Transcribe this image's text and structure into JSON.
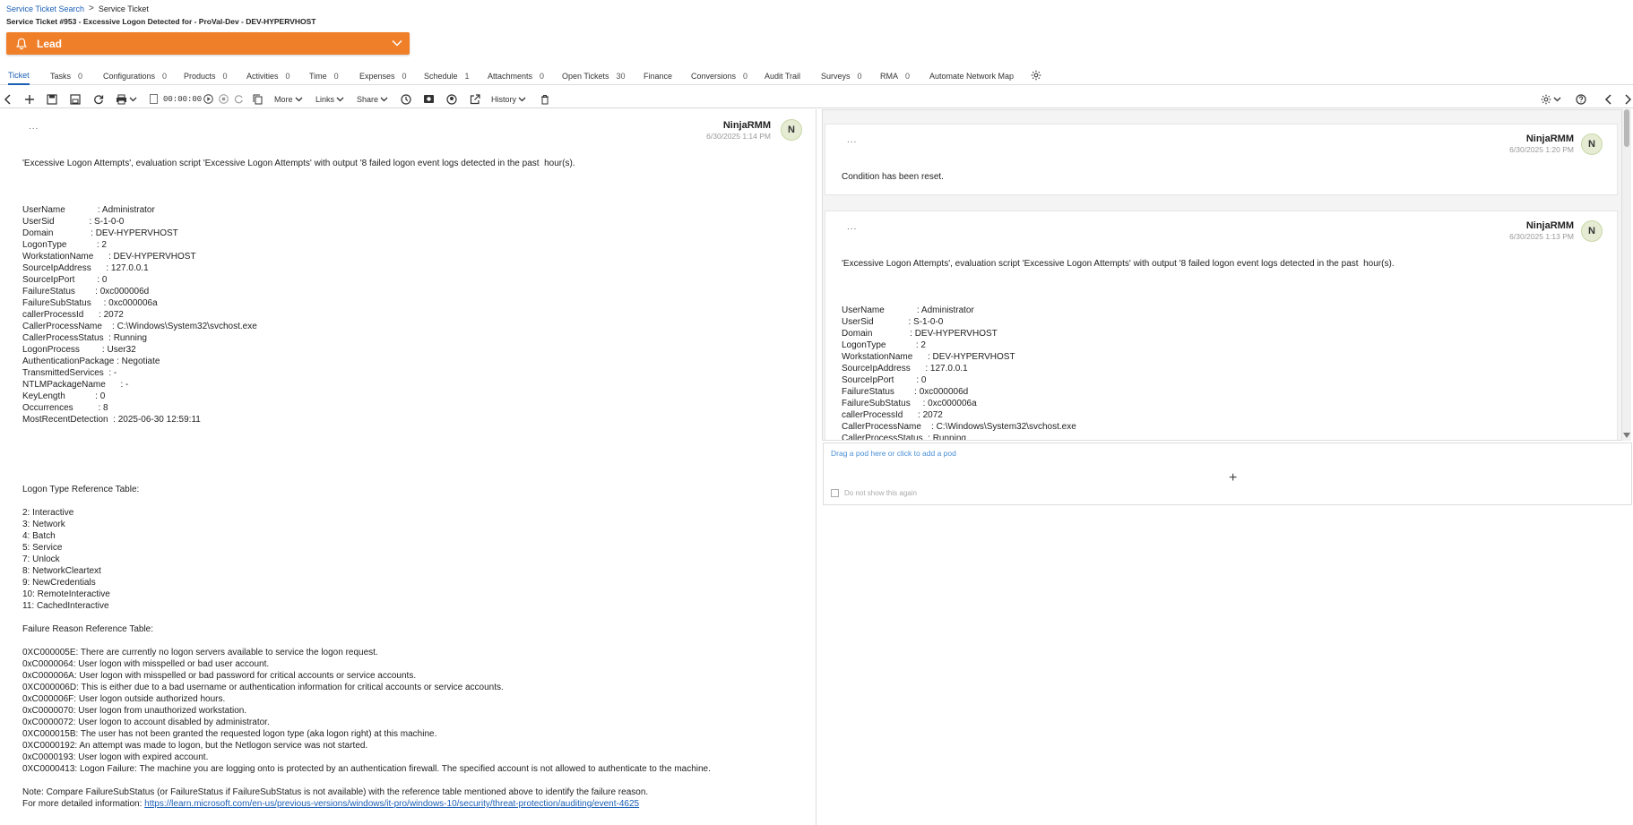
{
  "breadcrumb": {
    "search_link": "Service Ticket Search",
    "separator": ">",
    "current": "Service Ticket"
  },
  "title": "Service Ticket #953 - Excessive Logon Detected for - ProVal-Dev - DEV-HYPERVHOST",
  "status": {
    "label": "Lead",
    "color": "#f07f2a"
  },
  "tabs": [
    {
      "label": "Ticket",
      "count": ""
    },
    {
      "label": "Tasks",
      "count": "0"
    },
    {
      "label": "Configurations",
      "count": "0"
    },
    {
      "label": "Products",
      "count": "0"
    },
    {
      "label": "Activities",
      "count": "0"
    },
    {
      "label": "Time",
      "count": "0"
    },
    {
      "label": "Expenses",
      "count": "0"
    },
    {
      "label": "Schedule",
      "count": "1"
    },
    {
      "label": "Attachments",
      "count": "0"
    },
    {
      "label": "Open Tickets",
      "count": "30"
    },
    {
      "label": "Finance",
      "count": ""
    },
    {
      "label": "Conversions",
      "count": "0"
    },
    {
      "label": "Audit Trail",
      "count": ""
    },
    {
      "label": "Surveys",
      "count": "0"
    },
    {
      "label": "RMA",
      "count": "0"
    },
    {
      "label": "Automate Network Map",
      "count": ""
    }
  ],
  "toolbar": {
    "timer": "00:00:00",
    "more": "More",
    "links": "Links",
    "share": "Share",
    "history": "History"
  },
  "left_note": {
    "dots": "...",
    "author": "NinjaRMM",
    "date": "6/30/2025 1:14 PM",
    "avatar": "N",
    "body": "'Excessive Logon Attempts', evaluation script 'Excessive Logon Attempts' with output '8 failed logon event logs detected in the past  hour(s).\n\n\n\nUserName             : Administrator\nUserSid              : S-1-0-0\nDomain               : DEV-HYPERVHOST\nLogonType            : 2\nWorkstationName      : DEV-HYPERVHOST\nSourceIpAddress      : 127.0.0.1\nSourceIpPort         : 0\nFailureStatus        : 0xc000006d\nFailureSubStatus     : 0xc000006a\ncallerProcessId      : 2072\nCallerProcessName    : C:\\Windows\\System32\\svchost.exe\nCallerProcessStatus  : Running\nLogonProcess         : User32\nAuthenticationPackage : Negotiate\nTransmittedServices  : -\nNTLMPackageName      : -\nKeyLength            : 0\nOccurrences          : 8\nMostRecentDetection  : 2025-06-30 12:59:11\n\n\n\n\n\nLogon Type Reference Table:\n\n2: Interactive\n3: Network\n4: Batch\n5: Service\n7: Unlock\n8: NetworkCleartext\n9: NewCredentials\n10: RemoteInteractive\n11: CachedInteractive\n\nFailure Reason Reference Table:\n\n0XC000005E: There are currently no logon servers available to service the logon request.\n0xC0000064: User logon with misspelled or bad user account.\n0xC000006A: User logon with misspelled or bad password for critical accounts or service accounts.\n0XC000006D: This is either due to a bad username or authentication information for critical accounts or service accounts.\n0xC000006F: User logon outside authorized hours.\n0xC0000070: User logon from unauthorized workstation.\n0xC0000072: User logon to account disabled by administrator.\n0XC000015B: The user has not been granted the requested logon type (aka logon right) at this machine.\n0XC0000192: An attempt was made to logon, but the Netlogon service was not started.\n0xC0000193: User logon with expired account.\n0XC0000413: Logon Failure: The machine you are logging onto is protected by an authentication firewall. The specified account is not allowed to authenticate to the machine.\n\nNote: Compare FailureSubStatus (or FailureStatus if FailureSubStatus is not available) with the reference table mentioned above to identify the failure reason.\n",
    "more_info_label": "For more detailed information: ",
    "more_info_link": "https://learn.microsoft.com/en-us/previous-versions/windows/it-pro/windows-10/security/threat-protection/auditing/event-4625"
  },
  "right_notes": [
    {
      "dots": "...",
      "author": "NinjaRMM",
      "date": "6/30/2025 1:20 PM",
      "avatar": "N",
      "body": "Condition has been reset."
    },
    {
      "dots": "...",
      "author": "NinjaRMM",
      "date": "6/30/2025 1:13 PM",
      "avatar": "N",
      "body": "'Excessive Logon Attempts', evaluation script 'Excessive Logon Attempts' with output '8 failed logon event logs detected in the past  hour(s).\n\n\n\nUserName             : Administrator\nUserSid              : S-1-0-0\nDomain               : DEV-HYPERVHOST\nLogonType            : 2\nWorkstationName      : DEV-HYPERVHOST\nSourceIpAddress      : 127.0.0.1\nSourceIpPort         : 0\nFailureStatus        : 0xc000006d\nFailureSubStatus     : 0xc000006a\ncallerProcessId      : 2072\nCallerProcessName    : C:\\Windows\\System32\\svchost.exe\nCallerProcessStatus  : Running"
    }
  ],
  "drop_pod": {
    "hint": "Drag a pod here or click to add a pod",
    "plus": "+",
    "checkbox_label": "Do not show this again"
  }
}
